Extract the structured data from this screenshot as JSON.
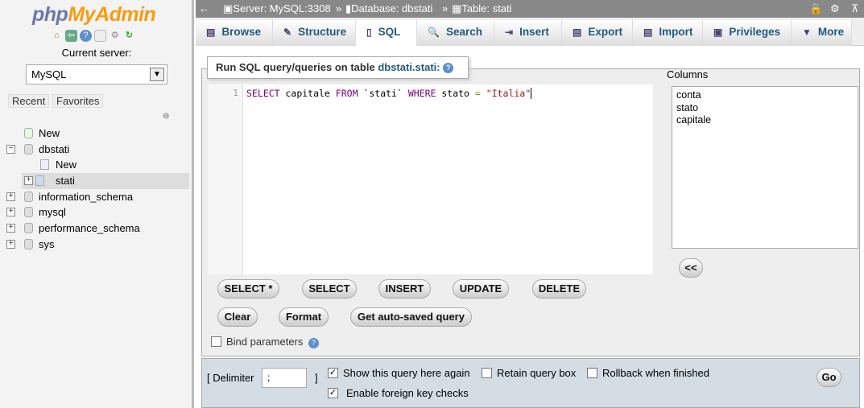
{
  "sidebar": {
    "logo": {
      "a": "php",
      "b": "MyAdmin"
    },
    "current_server_label": "Current server:",
    "server_value": "MySQL",
    "recent": "Recent",
    "favorites": "Favorites",
    "tree": [
      {
        "label": "New",
        "level": 1,
        "icon": "new-icon"
      },
      {
        "label": "dbstati",
        "level": 0,
        "expanded": true
      },
      {
        "label": "New",
        "level": 2,
        "icon": "new-icon"
      },
      {
        "label": "stati",
        "level": 2,
        "selected": true,
        "icon": "table-icon"
      },
      {
        "label": "information_schema",
        "level": 0
      },
      {
        "label": "mysql",
        "level": 0
      },
      {
        "label": "performance_schema",
        "level": 0
      },
      {
        "label": "sys",
        "level": 0
      }
    ]
  },
  "breadcrumb": {
    "server": "Server: MySQL:3308",
    "sep": "»",
    "database": "Database: dbstati",
    "table": "Table: stati"
  },
  "tabs": [
    {
      "label": "Browse",
      "icon": "▤"
    },
    {
      "label": "Structure",
      "icon": "✎"
    },
    {
      "label": "SQL",
      "icon": "▯"
    },
    {
      "label": "Search",
      "icon": "🔍"
    },
    {
      "label": "Insert",
      "icon": "⇥"
    },
    {
      "label": "Export",
      "icon": "▤"
    },
    {
      "label": "Import",
      "icon": "▤"
    },
    {
      "label": "Privileges",
      "icon": "▣"
    },
    {
      "label": "More",
      "icon": "▼"
    }
  ],
  "query": {
    "legend": "Run SQL query/queries on table",
    "legend_table": "dbstati.stati:",
    "line_number": "1",
    "code": {
      "k1": "SELECT",
      "t1": " capitale ",
      "k2": "FROM",
      "t2": " `stati` ",
      "k3": "WHERE",
      "t3": " stato ",
      "op": "=",
      "t4": " ",
      "s": "\"Italia\""
    },
    "columns_label": "Columns",
    "columns": [
      "conta",
      "stato",
      "capitale"
    ],
    "insert_button": "<<",
    "buttons_row1": [
      "SELECT *",
      "SELECT",
      "INSERT",
      "UPDATE",
      "DELETE"
    ],
    "buttons_row2": [
      "Clear",
      "Format",
      "Get auto-saved query"
    ],
    "bind_parameters": "Bind parameters"
  },
  "footer": {
    "delimiter_label": "[ Delimiter",
    "delimiter_value": ";",
    "delimiter_close": "]",
    "show_again": "Show this query here again",
    "show_again_checked": true,
    "retain": "Retain query box",
    "retain_checked": false,
    "rollback": "Rollback when finished",
    "rollback_checked": false,
    "fk_checks": "Enable foreign key checks",
    "fk_checks_checked": true,
    "go": "Go"
  }
}
